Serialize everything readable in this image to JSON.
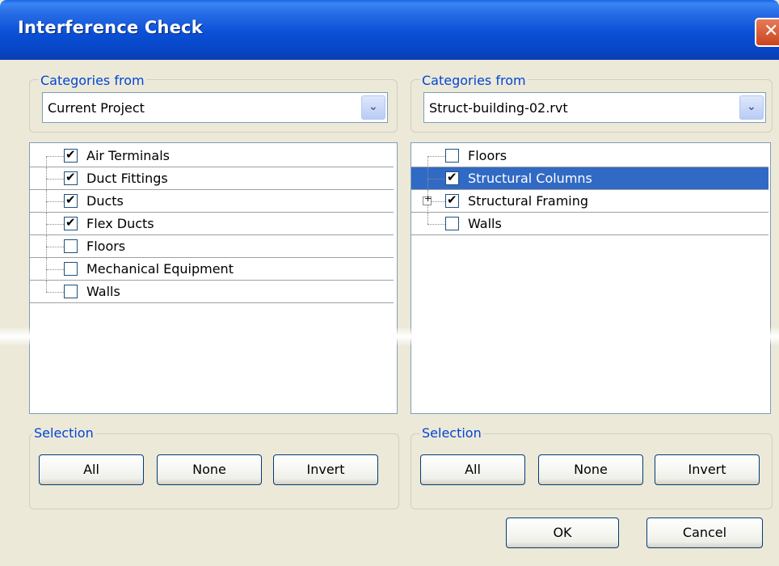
{
  "window": {
    "title": "Interference Check",
    "close_glyph": "✕"
  },
  "left": {
    "group_label": "Categories from",
    "source": "Current Project",
    "items": [
      {
        "label": "Air Terminals",
        "checked": true
      },
      {
        "label": "Duct Fittings",
        "checked": true
      },
      {
        "label": "Ducts",
        "checked": true
      },
      {
        "label": "Flex Ducts",
        "checked": true
      },
      {
        "label": "Floors",
        "checked": false
      },
      {
        "label": "Mechanical Equipment",
        "checked": false
      },
      {
        "label": "Walls",
        "checked": false
      }
    ],
    "selection_label": "Selection",
    "buttons": {
      "all": "All",
      "none": "None",
      "invert": "Invert"
    }
  },
  "right": {
    "group_label": "Categories from",
    "source": "Struct-building-02.rvt",
    "items": [
      {
        "label": "Floors",
        "checked": false,
        "selected": false,
        "expandable": false
      },
      {
        "label": "Structural Columns",
        "checked": true,
        "selected": true,
        "expandable": false
      },
      {
        "label": "Structural Framing",
        "checked": true,
        "selected": false,
        "expandable": true
      },
      {
        "label": "Walls",
        "checked": false,
        "selected": false,
        "expandable": false
      }
    ],
    "selection_label": "Selection",
    "buttons": {
      "all": "All",
      "none": "None",
      "invert": "Invert"
    }
  },
  "footer": {
    "ok": "OK",
    "cancel": "Cancel"
  },
  "icons": {
    "dropdown": "chevron-down-icon",
    "expand": "plus-icon",
    "check": "checkmark-icon"
  },
  "colors": {
    "titlebar": "#0a50d6",
    "selection_highlight": "#316ac5",
    "group_label": "#0046d5",
    "dialog_bg": "#ece9d8"
  }
}
